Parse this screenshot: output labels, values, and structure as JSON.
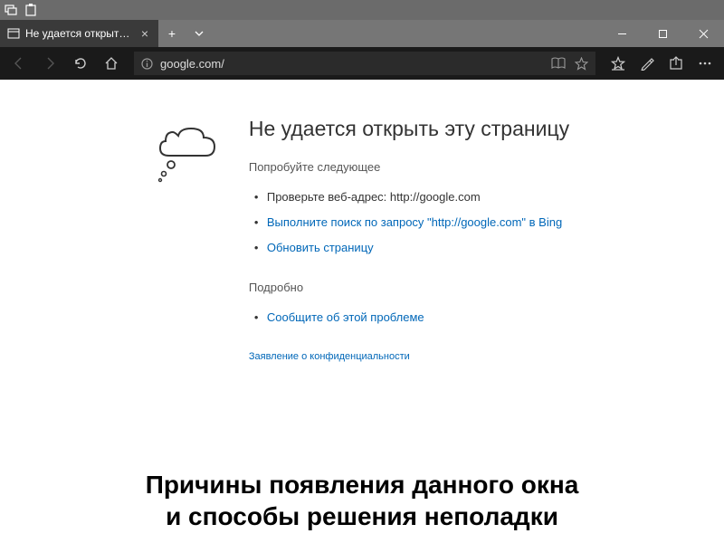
{
  "tab": {
    "title": "Не удается открыть эту"
  },
  "address": {
    "url": "google.com/"
  },
  "error": {
    "title": "Не удается открыть эту страницу",
    "try_label": "Попробуйте следующее",
    "check_prefix": "Проверьте веб-адрес: ",
    "check_url": "http://google.com",
    "search_prefix": "Выполните поиск по запросу \"",
    "search_url": "http://google.com",
    "search_suffix": "\" в Bing",
    "refresh": "Обновить страницу",
    "details_label": "Подробно",
    "report": "Сообщите об этой проблеме",
    "privacy": "Заявление о конфиденциальности"
  },
  "caption": {
    "line1": "Причины появления данного окна",
    "line2": "и способы решения неполадки"
  }
}
